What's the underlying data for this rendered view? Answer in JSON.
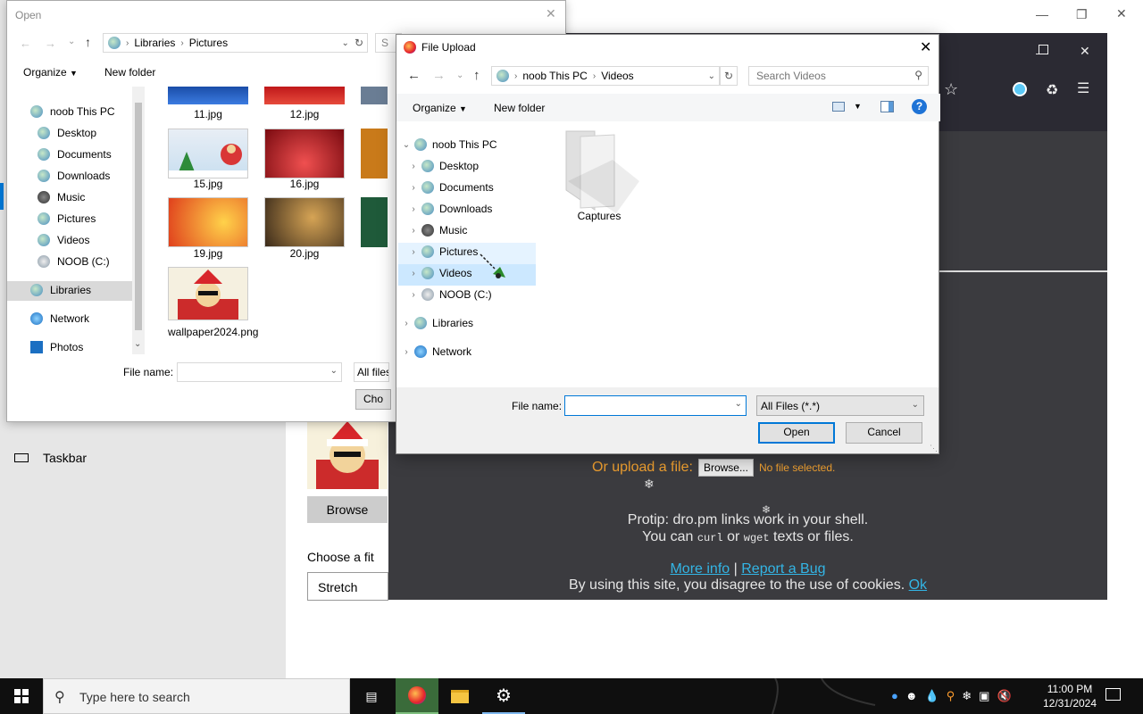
{
  "settings": {
    "taskbar_label": "Taskbar",
    "browse_button": "Browse",
    "choose_fit_label": "Choose a fit",
    "fit_value": "Stretch"
  },
  "browser": {
    "upload_prompt": "Or upload a file:",
    "browse_button": "Browse...",
    "no_file": "No file selected.",
    "protip_line1": "Protip: dro.pm links work in your shell.",
    "protip_line2_a": "You can",
    "protip_curl": "curl",
    "protip_or": "or",
    "protip_wget": "wget",
    "protip_line2_b": "texts or files.",
    "more_info": "More info",
    "separator": "|",
    "report_bug": "Report a Bug",
    "cookie_text": "By using this site, you disagree to the use of cookies.",
    "cookie_ok": "Ok"
  },
  "open_dialog": {
    "title": "Open",
    "breadcrumb": [
      "Libraries",
      "Pictures"
    ],
    "search_partial": "S",
    "organize": "Organize",
    "new_folder": "New folder",
    "nav_items": [
      {
        "label": "noob This PC",
        "icon": "pc-icon"
      },
      {
        "label": "Desktop",
        "icon": "desktop-icon"
      },
      {
        "label": "Documents",
        "icon": "documents-icon"
      },
      {
        "label": "Downloads",
        "icon": "downloads-icon"
      },
      {
        "label": "Music",
        "icon": "music-icon"
      },
      {
        "label": "Pictures",
        "icon": "pictures-icon"
      },
      {
        "label": "Videos",
        "icon": "videos-icon"
      },
      {
        "label": "NOOB (C:)",
        "icon": "drive-icon"
      },
      {
        "label": "Libraries",
        "icon": "libraries-icon"
      },
      {
        "label": "Network",
        "icon": "network-icon"
      },
      {
        "label": "Photos",
        "icon": "photos-icon"
      }
    ],
    "files": [
      {
        "name": "11.jpg"
      },
      {
        "name": "12.jpg"
      },
      {
        "name": "15.jpg"
      },
      {
        "name": "16.jpg"
      },
      {
        "name": "19.jpg"
      },
      {
        "name": "20.jpg"
      },
      {
        "name": "wallpaper2024.png"
      }
    ],
    "file_name_label": "File name:",
    "file_type_partial": "All files",
    "choose_partial": "Cho"
  },
  "upload_dialog": {
    "title": "File Upload",
    "breadcrumb": [
      "noob This PC",
      "Videos"
    ],
    "search_placeholder": "Search Videos",
    "organize": "Organize",
    "new_folder": "New folder",
    "tree": [
      {
        "label": "noob This PC",
        "icon": "pc-icon",
        "expanded": true
      },
      {
        "label": "Desktop",
        "icon": "desktop-icon"
      },
      {
        "label": "Documents",
        "icon": "documents-icon"
      },
      {
        "label": "Downloads",
        "icon": "downloads-icon"
      },
      {
        "label": "Music",
        "icon": "music-icon"
      },
      {
        "label": "Pictures",
        "icon": "pictures-icon"
      },
      {
        "label": "Videos",
        "icon": "videos-icon",
        "selected": true
      },
      {
        "label": "NOOB (C:)",
        "icon": "drive-icon"
      },
      {
        "label": "Libraries",
        "icon": "libraries-icon"
      },
      {
        "label": "Network",
        "icon": "network-icon"
      }
    ],
    "folder_item": "Captures",
    "file_name_label": "File name:",
    "file_name_value": "",
    "file_type": "All Files (*.*)",
    "open_button": "Open",
    "cancel_button": "Cancel"
  },
  "taskbar": {
    "search_placeholder": "Type here to search",
    "time": "11:00 PM",
    "date": "12/31/2024"
  }
}
